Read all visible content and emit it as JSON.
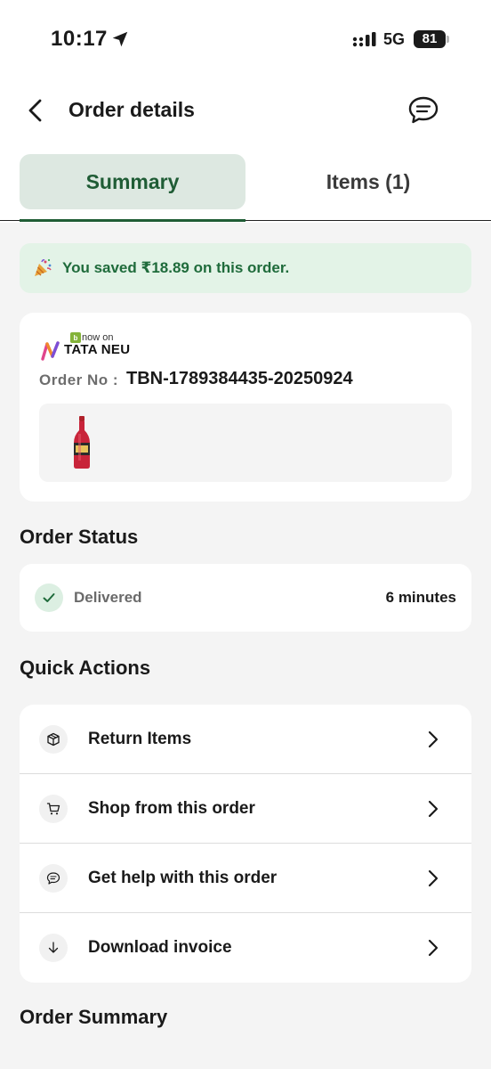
{
  "status_bar": {
    "time": "10:17",
    "network": "5G",
    "battery": "81"
  },
  "header": {
    "title": "Order details"
  },
  "tabs": [
    {
      "label": "Summary",
      "active": true
    },
    {
      "label": "Items (1)",
      "active": false
    }
  ],
  "savings": {
    "text": "You saved ₹18.89 on this order."
  },
  "order": {
    "logo_small": "now on",
    "logo_main": "TATA NEU",
    "order_no_label": "Order No :",
    "order_no_value": "TBN-1789384435-20250924"
  },
  "order_status": {
    "title": "Order Status",
    "status": "Delivered",
    "time": "6 minutes"
  },
  "quick_actions": {
    "title": "Quick Actions",
    "items": [
      {
        "label": "Return Items",
        "icon": "package-icon"
      },
      {
        "label": "Shop from this order",
        "icon": "cart-icon"
      },
      {
        "label": "Get help with this order",
        "icon": "chat-icon"
      },
      {
        "label": "Download invoice",
        "icon": "download-arrow-icon"
      }
    ]
  },
  "order_summary": {
    "title": "Order Summary"
  },
  "colors": {
    "accent_green": "#1f5c35",
    "savings_bg": "#e3f3e7",
    "tab_active_bg": "#dde8e1"
  }
}
